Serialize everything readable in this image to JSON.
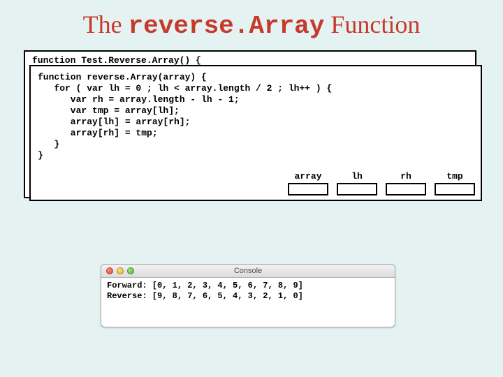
{
  "title": {
    "part1": "The ",
    "mono": "reverse.Array",
    "part2": " Function"
  },
  "back_code_line": "function Test.Reverse.Array() {",
  "code": "function reverse.Array(array) {\n   for ( var lh = 0 ; lh < array.length / 2 ; lh++ ) {\n      var rh = array.length - lh - 1;\n      var tmp = array[lh];\n      array[lh] = array[rh];\n      array[rh] = tmp;\n   }\n}",
  "vars": {
    "array": {
      "label": "array",
      "value": ""
    },
    "lh": {
      "label": "lh",
      "value": ""
    },
    "rh": {
      "label": "rh",
      "value": ""
    },
    "tmp": {
      "label": "tmp",
      "value": ""
    }
  },
  "console": {
    "window_title": "Console",
    "lines": "Forward: [0, 1, 2, 3, 4, 5, 6, 7, 8, 9]\nReverse: [9, 8, 7, 6, 5, 4, 3, 2, 1, 0]"
  }
}
